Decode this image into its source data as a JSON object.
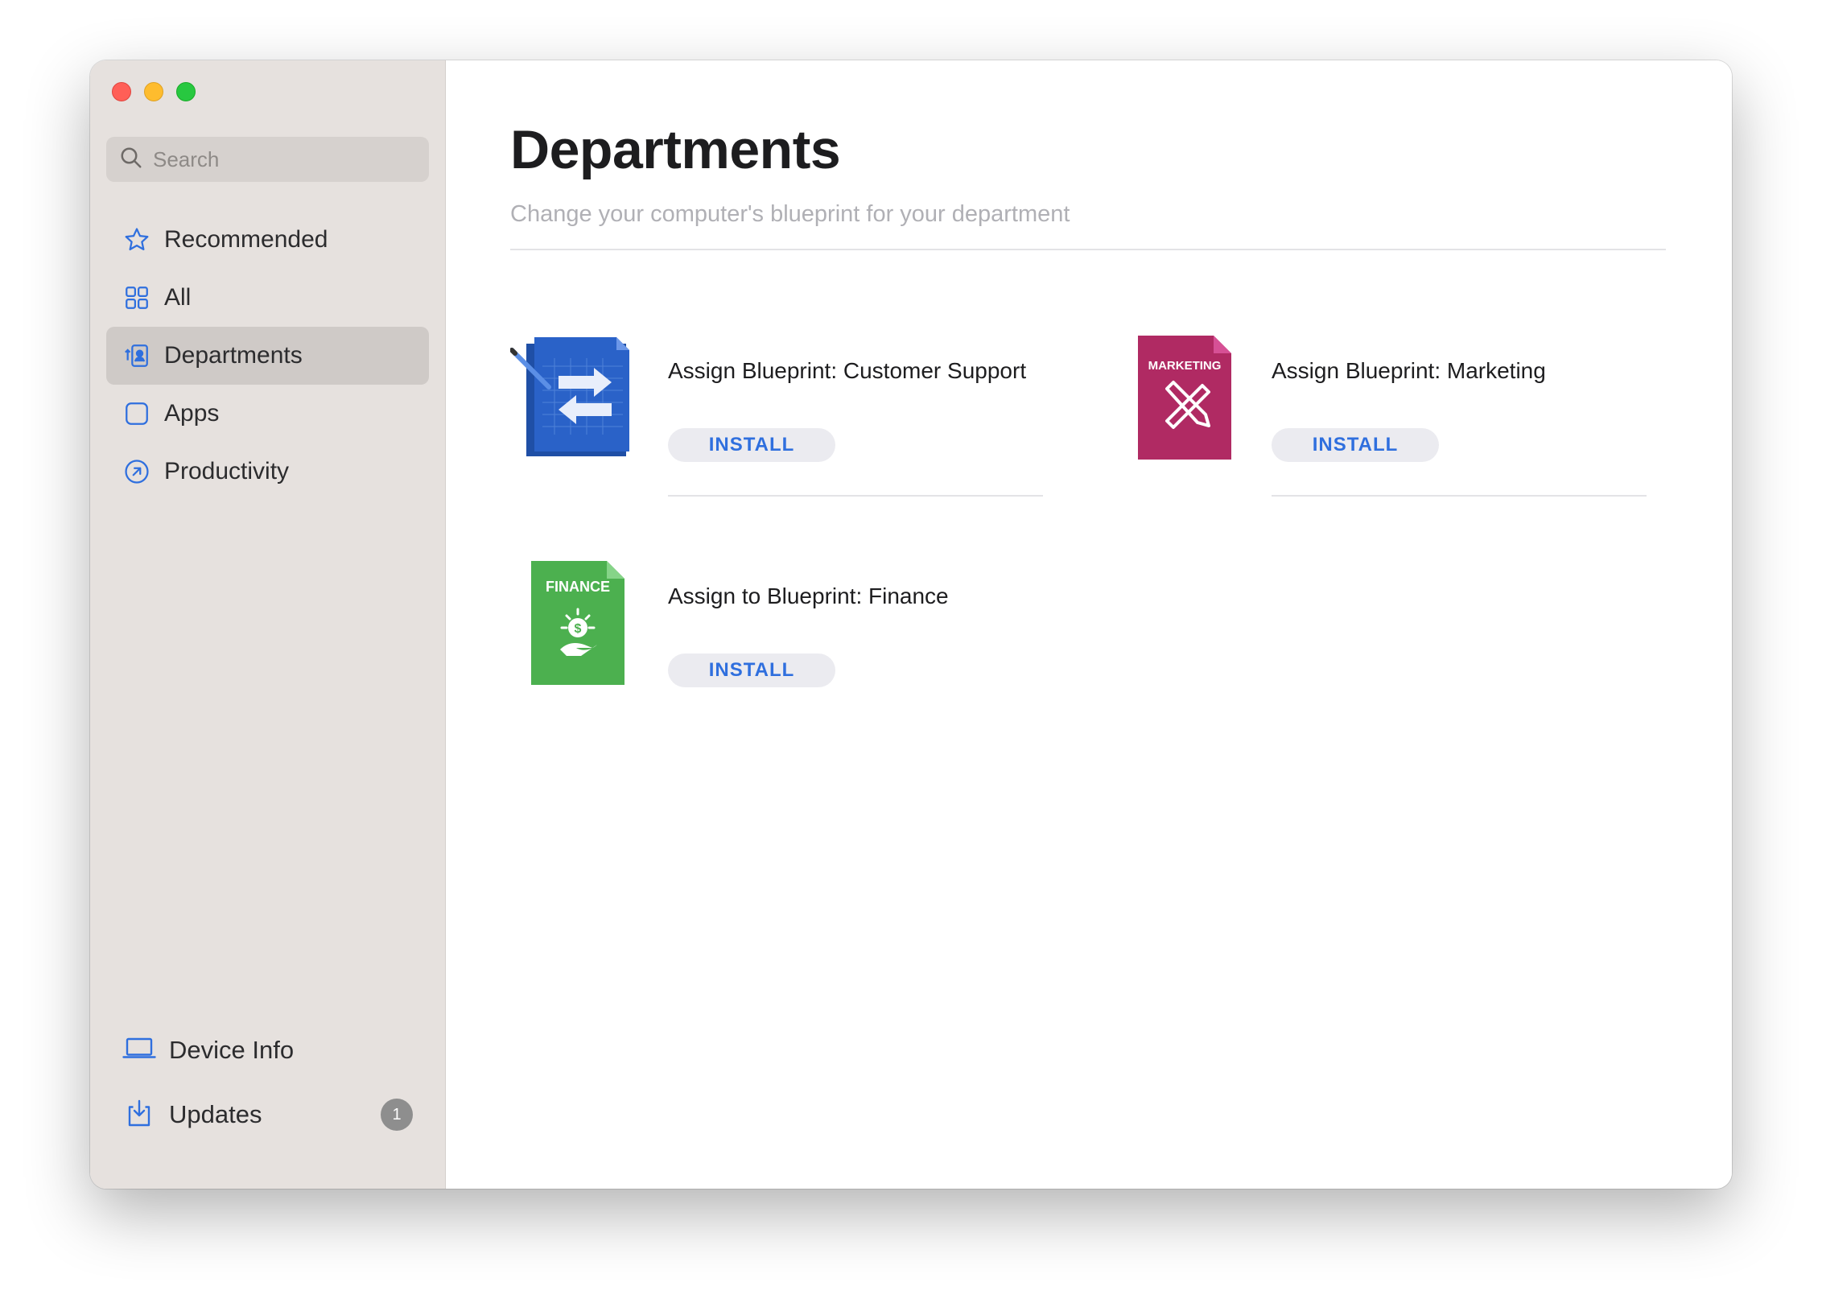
{
  "sidebar": {
    "search_placeholder": "Search",
    "items": [
      {
        "label": "Recommended",
        "icon": "star-icon"
      },
      {
        "label": "All",
        "icon": "grid-icon"
      },
      {
        "label": "Departments",
        "icon": "departments-icon",
        "selected": true
      },
      {
        "label": "Apps",
        "icon": "app-square-icon"
      },
      {
        "label": "Productivity",
        "icon": "arrow-circle-icon"
      }
    ],
    "bottom_items": [
      {
        "label": "Device Info",
        "icon": "laptop-icon"
      },
      {
        "label": "Updates",
        "icon": "download-tray-icon",
        "badge": "1"
      }
    ]
  },
  "main": {
    "title": "Departments",
    "subtitle": "Change your computer's blueprint for your department",
    "cards": [
      {
        "title": "Assign Blueprint: Customer Support",
        "button": "INSTALL",
        "icon": "customer-support-blueprint-icon"
      },
      {
        "title": "Assign Blueprint: Marketing",
        "button": "INSTALL",
        "icon": "marketing-blueprint-icon",
        "icon_label": "MARKETING"
      },
      {
        "title": "Assign to Blueprint: Finance",
        "button": "INSTALL",
        "icon": "finance-blueprint-icon",
        "icon_label": "FINANCE"
      }
    ]
  },
  "colors": {
    "accent": "#2f6fde",
    "sidebar_bg": "#e6e1de",
    "marketing": "#b02a63",
    "finance": "#4cb04f",
    "support": "#2a5fbf"
  }
}
